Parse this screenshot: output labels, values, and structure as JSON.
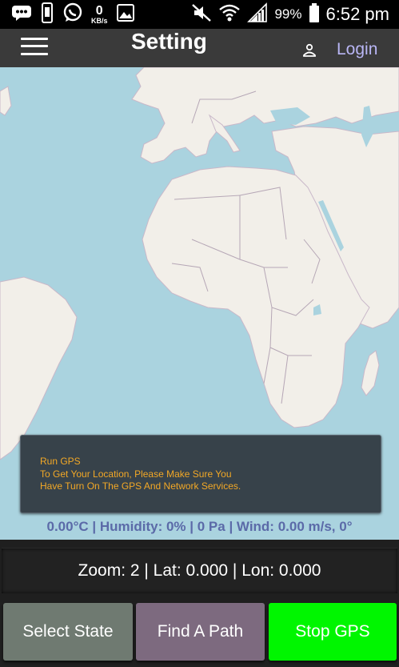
{
  "status_bar": {
    "icons": [
      "message-icon",
      "vibrate-phone-icon",
      "whatsapp-icon",
      "image-icon",
      "mute-icon",
      "wifi-icon",
      "signal-icon",
      "battery-icon"
    ],
    "net_speed_value": "0",
    "net_speed_unit": "KB/s",
    "battery_percent": "99%",
    "time": "6:52 pm"
  },
  "app_bar": {
    "title": "Setting",
    "login_label": "Login"
  },
  "map": {
    "water_color": "#aad3df",
    "land_color": "#f2efe9",
    "border_color": "#b6a7b6"
  },
  "notice": {
    "title": "Run GPS",
    "line1": "To Get Your Location, Please Make Sure You",
    "line2": "Have Turn On The GPS And Network Services."
  },
  "weather": {
    "text": "0.00°C | Humidity: 0% | 0 Pa | Wind: 0.00 m/s, 0°"
  },
  "coords": {
    "text": "Zoom: 2 | Lat: 0.000 | Lon: 0.000"
  },
  "buttons": {
    "select_state": "Select State",
    "find_path": "Find A Path",
    "stop_gps": "Stop GPS"
  }
}
